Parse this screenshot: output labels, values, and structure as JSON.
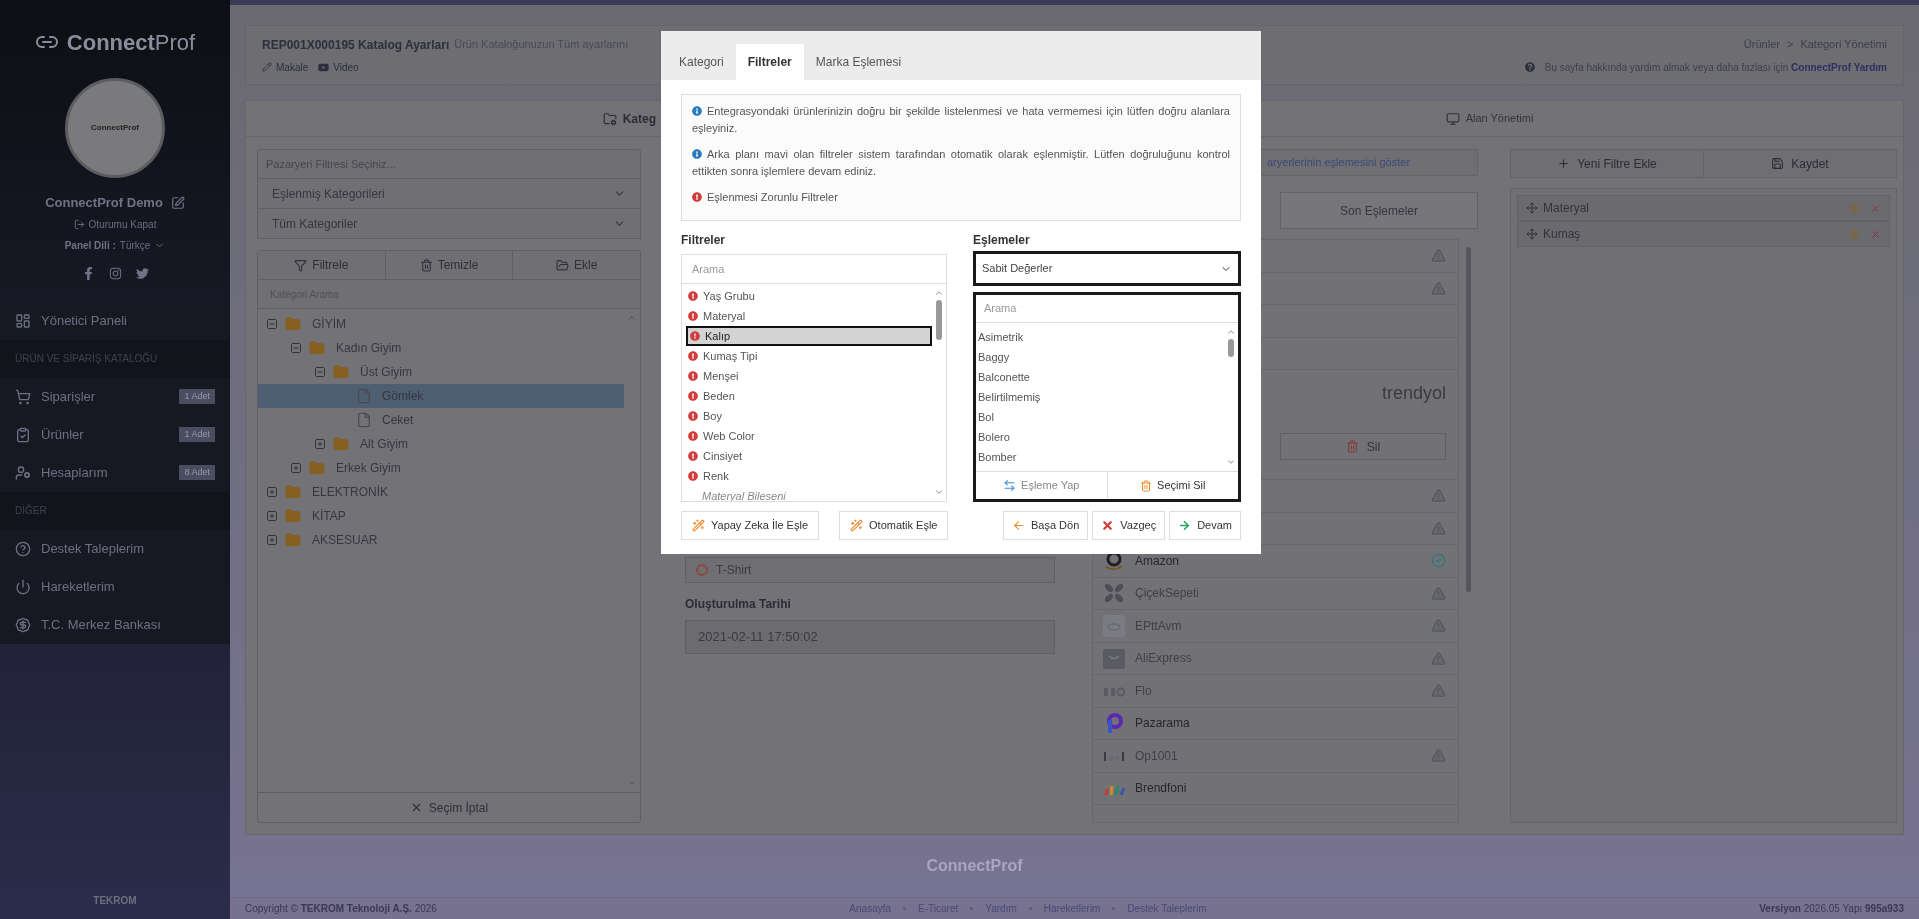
{
  "sidebar": {
    "brand": "**Connect**Prof",
    "avatar_logo": "ConnectProf",
    "user_name": "ConnectProf Demo",
    "logout": "Oturumu Kapat",
    "language_label": "Panel Dili :",
    "language": "Türkçe",
    "groups": [
      {
        "items": [
          {
            "label": "Yönetici Paneli",
            "kind": "dashboard"
          }
        ]
      },
      {
        "title": "ÜRÜN VE SİPARİŞ KATALOĞU",
        "items": [
          {
            "label": "Siparişler",
            "kind": "cart",
            "badge": "1 Adet"
          },
          {
            "label": "Ürünler",
            "kind": "clipboard",
            "badge": "1 Adet"
          },
          {
            "label": "Hesaplarım",
            "kind": "users",
            "badge": "8 Adet"
          }
        ]
      },
      {
        "title": "DİĞER",
        "items": [
          {
            "label": "Destek Taleplerim",
            "kind": "help"
          },
          {
            "label": "Hareketlerim",
            "kind": "power"
          },
          {
            "label": "T.C. Merkez Bankası",
            "kind": "exchange"
          }
        ]
      }
    ],
    "company": "TEKROM"
  },
  "header": {
    "title": "REP001X000195 Katalog Ayarları",
    "subtitle": "Ürün Kataloğunuzun Tüm ayarlarını",
    "links": [
      {
        "label": "Makale",
        "kind": "pencil"
      },
      {
        "label": "Video",
        "kind": "video"
      }
    ],
    "breadcrumb": {
      "items": [
        "Ürünler",
        "Kategori Yönetimi"
      ],
      "separator": ">"
    },
    "help_text": "Bu sayfa hakkında yardım almak veya daha fazlası için",
    "help_link": "ConnectProf Yardım"
  },
  "page_tabs": [
    {
      "label": "Kateg",
      "selected": true
    },
    {
      "label": "Alan Yönetimi",
      "selected": false
    }
  ],
  "left_panel": {
    "marketplace_filter_placeholder": "Pazaryeri Filtresi Seçiniz...",
    "selects": [
      "Eşlenmiş Kategorileri",
      "Tüm Kategoriler"
    ],
    "toolbar": [
      {
        "label": "Filtrele",
        "kind": "filter"
      },
      {
        "label": "Temizle",
        "kind": "trash"
      },
      {
        "label": "Ekle",
        "kind": "folder"
      }
    ],
    "search_placeholder": "Kategori Arama",
    "tree": [
      {
        "label": "GİYİM",
        "kind": "folder",
        "expanded": true,
        "selected": false,
        "children": [
          {
            "label": "Kadın Giyim",
            "kind": "folder",
            "expanded": true,
            "selected": false,
            "children": [
              {
                "label": "Üst Giyim",
                "kind": "folder",
                "expanded": true,
                "selected": false,
                "children": [
                  {
                    "label": "Gömlek",
                    "kind": "file",
                    "selected": true
                  },
                  {
                    "label": "Ceket",
                    "kind": "file",
                    "selected": false
                  }
                ]
              },
              {
                "label": "Alt Giyim",
                "kind": "folder",
                "expanded": false,
                "selected": false
              }
            ]
          },
          {
            "label": "Erkek Giyim",
            "kind": "folder",
            "expanded": false,
            "selected": false
          }
        ]
      },
      {
        "label": "ELEKTRONİK",
        "kind": "folder",
        "expanded": false,
        "selected": false
      },
      {
        "label": "KİTAP",
        "kind": "folder",
        "expanded": false,
        "selected": false
      },
      {
        "label": "AKSESUAR",
        "kind": "folder",
        "expanded": false,
        "selected": false
      }
    ],
    "cancel_button": "Seçim İptal"
  },
  "middle_panel": {
    "field_value": "T-Shirt",
    "created_label": "Oluşturulma Tarihi",
    "created_value": "2021-02-11 17:50:02"
  },
  "marketplace_panel": {
    "link_text": "aryerlerinin eşlemesini göster",
    "tabs": [
      {
        "label": "Son Eşlemeler",
        "selected": false
      }
    ],
    "rows_top": [
      {
        "warning": true,
        "verified": false
      },
      {
        "warning": true,
        "verified": false
      },
      {
        "warning": false,
        "verified": false
      },
      {
        "warning": false,
        "verified": false
      }
    ],
    "selected_card": {
      "logo_text": "trendyol",
      "delete_button": "Sil"
    },
    "rows": [
      {
        "warning": true,
        "verified": false
      },
      {
        "warning": true,
        "verified": false
      },
      {
        "name": "Amazon",
        "kind": "amazon",
        "warning": false,
        "verified": true,
        "active": true
      },
      {
        "name": "ÇiçekSepeti",
        "kind": "flower",
        "warning": true,
        "verified": false,
        "active": false
      },
      {
        "name": "EPttAvm",
        "kind": "ptt",
        "warning": true,
        "verified": false,
        "active": false
      },
      {
        "name": "AliExpress",
        "kind": "bag",
        "warning": true,
        "verified": false,
        "active": false
      },
      {
        "name": "Flo",
        "kind": "flo",
        "warning": true,
        "verified": false,
        "active": false
      },
      {
        "name": "Pazarama",
        "kind": "pazarama",
        "warning": false,
        "verified": false,
        "active": true
      },
      {
        "name": "Op1001",
        "kind": "dots",
        "warning": true,
        "verified": false,
        "active": false
      },
      {
        "name": "Brendfoni",
        "kind": "strokes",
        "warning": false,
        "verified": false,
        "active": true
      }
    ]
  },
  "filter_panel": {
    "buttons": [
      {
        "label": "Yeni Filtre Ekle",
        "kind": "plus"
      },
      {
        "label": "Kaydet",
        "kind": "save"
      }
    ],
    "items": [
      {
        "label": "Materyal"
      },
      {
        "label": "Kumaş"
      }
    ]
  },
  "modal": {
    "tabs": [
      {
        "label": "Kategori",
        "selected": false
      },
      {
        "label": "Filtreler",
        "selected": true
      },
      {
        "label": "Marka Eşlemesi",
        "selected": false
      }
    ],
    "notes": [
      {
        "kind": "info",
        "text": "Entegrasyondaki ürünlerinizin doğru bir şekilde listelenmesi ve hata vermemesi için lütfen doğru alanlara eşleyiniz."
      },
      {
        "kind": "info",
        "text": "Arka planı mavi olan filtreler sistem tarafından otomatik olarak eşlenmiştir. Lütfen doğruluğunu kontrol ettikten sonra işlemlere devam ediniz."
      },
      {
        "kind": "required",
        "text": "Eşlenmesi Zorunlu Filtreler"
      }
    ],
    "filters": {
      "title": "Filtreler",
      "search_placeholder": "Arama",
      "items": [
        {
          "label": "Yaş Grubu",
          "kind": "required",
          "selected": false
        },
        {
          "label": "Materyal",
          "kind": "required",
          "selected": false
        },
        {
          "label": "Kalıp",
          "kind": "required",
          "selected": true
        },
        {
          "label": "Kumaş Tipi",
          "kind": "required",
          "selected": false
        },
        {
          "label": "Menşei",
          "kind": "required",
          "selected": false
        },
        {
          "label": "Beden",
          "kind": "required",
          "selected": false
        },
        {
          "label": "Boy",
          "kind": "required",
          "selected": false
        },
        {
          "label": "Web Color",
          "kind": "required",
          "selected": false
        },
        {
          "label": "Cinsiyet",
          "kind": "required",
          "selected": false
        },
        {
          "label": "Renk",
          "kind": "required",
          "selected": false
        },
        {
          "label": "Materyal Bileseni",
          "kind": "group",
          "selected": false
        }
      ]
    },
    "mappings": {
      "title": "Eşlemeler",
      "select_value": "Sabit Değerler",
      "search_placeholder": "Arama",
      "values": [
        "Asimetrik",
        "Baggy",
        "Balconette",
        "Belirtilmemiş",
        "Bol",
        "Bolero",
        "Bomber"
      ],
      "actions": [
        {
          "label": "Eşleme Yap",
          "kind": "swap"
        },
        {
          "label": "Seçimi Sil",
          "kind": "trash"
        }
      ]
    },
    "buttons_left": [
      {
        "label": "Yapay Zeka İle Eşle",
        "kind": "wand"
      },
      {
        "label": "Otomatik Eşle",
        "kind": "wand"
      }
    ],
    "buttons_right": [
      {
        "label": "Başa Dön",
        "kind": "back"
      },
      {
        "label": "Vazgeç",
        "kind": "cancel"
      },
      {
        "label": "Devam",
        "kind": "next"
      }
    ]
  },
  "footer": {
    "brand": "ConnectProf",
    "copyright": "Copyright © **TEKROM Teknoloji A.Ş.** 2026",
    "links": [
      "Anasayfa",
      "E-Ticaret",
      "Yardım",
      "Hareketlerim",
      "Destek Taleplerim"
    ],
    "version": "**Versiyon** 2026.05 Yapı **995a933**"
  }
}
